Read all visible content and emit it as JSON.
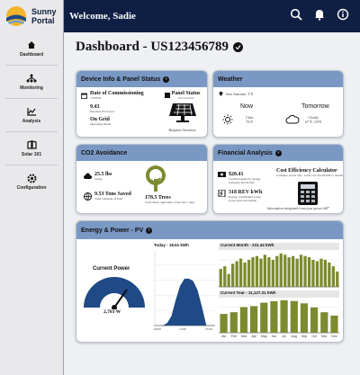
{
  "app": {
    "name_line1": "Sunny",
    "name_line2": "Portal"
  },
  "header": {
    "welcome": "Welcome, Sadie"
  },
  "sidebar": {
    "items": [
      {
        "label": "Dashboard"
      },
      {
        "label": "Monitoring"
      },
      {
        "label": "Analysis"
      },
      {
        "label": "Solar 101"
      },
      {
        "label": "Configuration"
      }
    ]
  },
  "page": {
    "title": "Dashboard - US123456789"
  },
  "device": {
    "title": "Device Info & Panel Status",
    "commission_label": "Date of Commissioning",
    "commission_date": "7/3/2024",
    "rated_value": "9.43",
    "rated_label": "Installed PV Power",
    "grid_value": "On Grid",
    "grid_label": "Operating Mode",
    "panel_status_label": "Panel Status",
    "panel_status_sub": "12/12 Active",
    "panel_status_note": "Requires Attention"
  },
  "weather": {
    "title": "Weather",
    "location": "San Antonio, TX",
    "now_label": "Now",
    "now_cond": "Clear",
    "now_temp": "76°F",
    "tomorrow_label": "Tomorrow",
    "tomorrow_cond": "Cloudy",
    "tomorrow_temp": "67°F | 59°F"
  },
  "co2": {
    "title": "CO2 Avoidance",
    "lbs_value": "25.5 lbs",
    "lbs_label": "Today",
    "tons_value": "9.53 Tons Saved",
    "tons_label": "Total Lifespan of Unit",
    "trees_value": "178.5 Trees",
    "trees_label": "CO2 offset equivalent of the last 7 days"
  },
  "finance": {
    "title": "Financial Analysis",
    "credits_value": "$20.41",
    "credits_label": "Credits bought by energy company last month",
    "rev_value": "318 REV kWh",
    "rev_label": "Energy contributed to the power grid last month",
    "calc_title": "Cost Efficiency Calculator",
    "calc_sub": "Compare power bill - solar over last month to month",
    "footer": "Information integrated from your power bill*"
  },
  "energy": {
    "title": "Energy & Power - PV",
    "current_power_label": "Current Power",
    "current_power_value": "2,703 W",
    "today_label": "Today - 18.61 kWh",
    "month_label": "Current Month - 231.34 kWh",
    "year_label": "Current Year - 11,127.21 kWh",
    "today_axis": [
      "00:00",
      "12:00",
      "23:59"
    ],
    "year_months": [
      "Jan",
      "Feb",
      "Mar",
      "Apr",
      "May",
      "Jun",
      "Jul",
      "Aug",
      "Sep",
      "Oct",
      "Nov",
      "Dec"
    ]
  },
  "colors": {
    "navy": "#0f1f44",
    "card_head": "#7a98c4",
    "bar": "#7d8a30",
    "gauge": "#1f4a86"
  },
  "icons": {
    "search": "search-icon",
    "bell": "bell-icon",
    "info": "info-icon"
  },
  "chart_data": [
    {
      "type": "area",
      "title": "Today - 18.61 kWh",
      "x": [
        "00:00",
        "12:00",
        "23:59"
      ],
      "values": [
        0,
        0,
        0,
        0.05,
        0.2,
        0.55,
        0.85,
        1.0,
        1.0,
        0.95,
        0.75,
        0.4,
        0,
        0,
        0
      ],
      "note": "daily power curve (normalized)"
    },
    {
      "type": "bar",
      "title": "Current Month - 231.34 kWh",
      "values": [
        14,
        16,
        10,
        18,
        20,
        22,
        19,
        21,
        23,
        24,
        22,
        25,
        23,
        21,
        24,
        26,
        25,
        23,
        24,
        22,
        25,
        24,
        23,
        21,
        20,
        22,
        21,
        19,
        16,
        12
      ]
    },
    {
      "type": "bar",
      "title": "Current Year - 11,127.21 kWh",
      "categories": [
        "Jan",
        "Feb",
        "Mar",
        "Apr",
        "May",
        "Jun",
        "Jul",
        "Aug",
        "Sep",
        "Oct",
        "Nov",
        "Dec"
      ],
      "values": [
        55,
        60,
        75,
        78,
        88,
        92,
        95,
        93,
        86,
        74,
        60,
        50
      ]
    }
  ]
}
